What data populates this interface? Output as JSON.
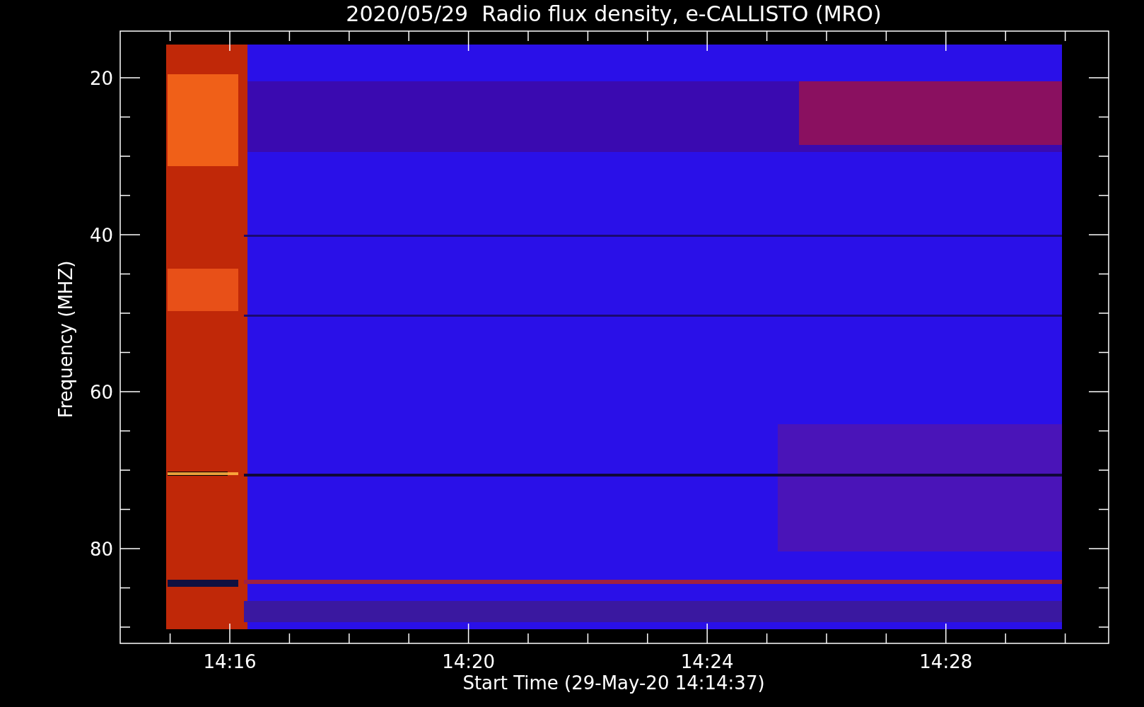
{
  "title": "2020/05/29  Radio flux density, e-CALLISTO (MRO)",
  "x_axis": {
    "label": "Start Time (29-May-20 14:14:37)",
    "ticks": [
      "14:16",
      "14:20",
      "14:24",
      "14:28"
    ]
  },
  "y_axis": {
    "label": "Frequency (MHZ)",
    "ticks": [
      "20",
      "40",
      "60",
      "80"
    ]
  }
}
